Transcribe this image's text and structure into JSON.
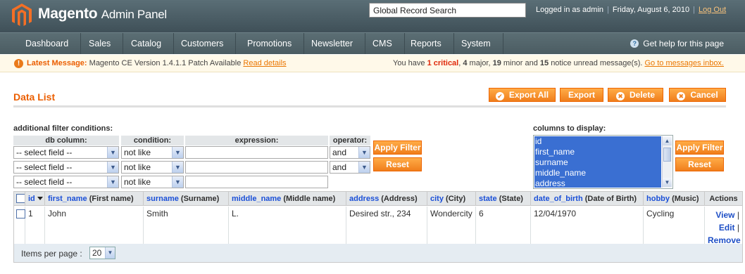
{
  "header": {
    "brand": "Magento",
    "brand_sub": "Admin Panel",
    "search_value": "Global Record Search",
    "logged_in": "Logged in as admin",
    "date": "Friday, August 6, 2010",
    "logout": "Log Out"
  },
  "nav": {
    "items": [
      "Dashboard",
      "Sales",
      "Catalog",
      "Customers",
      "Promotions",
      "Newsletter",
      "CMS",
      "Reports",
      "System"
    ],
    "help": "Get help for this page"
  },
  "message": {
    "latest_label": "Latest Message:",
    "latest_text": "Magento CE Version 1.4.1.1 Patch Available",
    "read_details": "Read details",
    "summary_prefix": "You have",
    "critical_count": "1",
    "critical_label": "critical",
    "major": "4",
    "major_label": "major,",
    "minor": "19",
    "minor_label": "minor and",
    "notice": "15",
    "notice_label": "notice unread message(s).",
    "inbox_link": "Go to messages inbox."
  },
  "page": {
    "title": "Data List",
    "buttons": {
      "export_all": "Export All",
      "export": "Export",
      "delete": "Delete",
      "cancel": "Cancel"
    }
  },
  "filter": {
    "section_label": "additional filter conditions:",
    "headers": {
      "db_column": "db column:",
      "condition": "condition:",
      "expression": "expression:",
      "operator": "operator:"
    },
    "rows": [
      {
        "field": "-- select field --",
        "condition": "not like",
        "expression": "",
        "operator": "and"
      },
      {
        "field": "-- select field --",
        "condition": "not like",
        "expression": "",
        "operator": "and"
      },
      {
        "field": "-- select field --",
        "condition": "not like",
        "expression": ""
      }
    ],
    "apply": "Apply Filter",
    "reset": "Reset"
  },
  "columns": {
    "label": "columns to display:",
    "options": [
      "id",
      "first_name",
      "surname",
      "middle_name",
      "address"
    ],
    "apply": "Apply Filter",
    "reset": "Reset"
  },
  "grid": {
    "headers": [
      {
        "key": "id",
        "label": ""
      },
      {
        "key": "first_name",
        "label": "(First name)"
      },
      {
        "key": "surname",
        "label": "(Surname)"
      },
      {
        "key": "middle_name",
        "label": "(Middle name)"
      },
      {
        "key": "address",
        "label": "(Address)"
      },
      {
        "key": "city",
        "label": "(City)"
      },
      {
        "key": "state",
        "label": "(State)"
      },
      {
        "key": "date_of_birth",
        "label": "(Date of Birth)"
      },
      {
        "key": "hobby",
        "label": "(Music)"
      },
      {
        "key": "",
        "label": "Actions"
      }
    ],
    "rows": [
      {
        "id": "1",
        "first_name": "John",
        "surname": "Smith",
        "middle_name": "L.",
        "address": "Desired str., 234",
        "city": "Wondercity",
        "state": "6",
        "date_of_birth": "12/04/1970",
        "hobby": "Cycling",
        "actions": [
          "View",
          "Edit",
          "Remove"
        ]
      }
    ]
  },
  "pager": {
    "label": "Items per page :",
    "value": "20"
  }
}
